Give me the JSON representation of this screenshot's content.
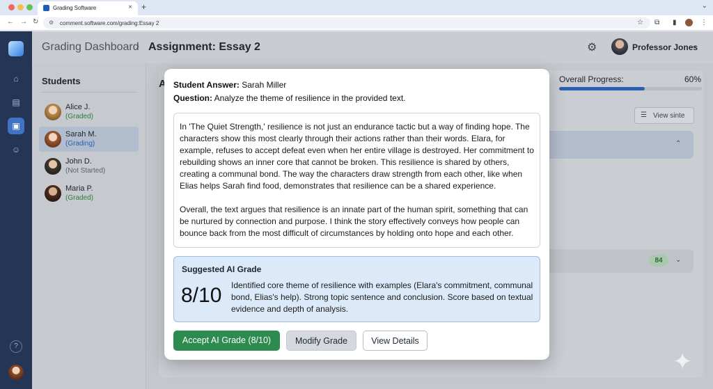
{
  "browser": {
    "tab_title": "Grading Software",
    "tab_close": "×",
    "new_tab": "+",
    "url": "comment.software.com/grading:Essay 2",
    "traffic_colors": [
      "#ed6a5e",
      "#f4bf4f",
      "#61c554"
    ]
  },
  "icons": {
    "back": "←",
    "forward": "→",
    "reload": "↻",
    "site": "⚙",
    "star": "☆",
    "extensions": "⧉",
    "sidebar": "▮",
    "menu": "⋮",
    "dropdown": "⌄",
    "home": "⌂",
    "docs": "▤",
    "grading": "▣",
    "users": "☺",
    "help": "?",
    "gear": "⚙",
    "chevron": "⌄",
    "chevron_up": "⌃",
    "list": "☰",
    "sparkle": "✦"
  },
  "header": {
    "breadcrumb_root": "Grading Dashboard",
    "breadcrumb_sep": "›",
    "page_title": "Assignment: Essay 2",
    "user_name": "Professor Jones"
  },
  "students": {
    "title": "Students",
    "items": [
      {
        "name": "Alice J.",
        "status": "(Graded)",
        "status_color": "#2f7d3c"
      },
      {
        "name": "Sarah M.",
        "status": "(Grading)",
        "status_color": "#2a5fb0"
      },
      {
        "name": "John D.",
        "status": "(Not Started)",
        "status_color": "#5b636e"
      },
      {
        "name": "Maria P.",
        "status": "(Graded)",
        "status_color": "#2f7d3c"
      }
    ]
  },
  "main": {
    "title_initial": "A",
    "progress_label": "Overall Progress:",
    "progress_pct": "60%",
    "progress_value": 0.6,
    "view_button": "View sinte",
    "badge_score": "84"
  },
  "modal": {
    "answer_label": "Student Answer:",
    "student_name": "Sarah Miller",
    "question_label": "Question:",
    "question_text": "Analyze the theme of resilience in the provided text.",
    "answer_p1": "In 'The Quiet Strength,' resilience is not just an endurance tactic but a way of finding hope. The characters show this most clearly through their actions rather than their words. Elara, for example, refuses to accept defeat even when her entire village is destroyed. Her commitment to rebuilding shows an inner core that cannot be broken. This resilience is shared by others, creating a communal bond. The way the characters draw strength from each other, like when Elias helps Sarah find food, demonstrates that resilience can be a shared experience.",
    "answer_p2": "Overall, the text argues that resilience is an innate part of the human spirit, something that can be nurtured by connection and purpose. I think the story effectively conveys how people can bounce back from the most difficult of circumstances by holding onto hope and each other.",
    "ai_title": "Suggested AI Grade",
    "ai_score": "8/10",
    "ai_description": "Identified core theme of resilience with examples (Elara's commitment, communal bond, Elias's help). Strong topic sentence and conclusion. Score based on textual evidence and depth of analysis.",
    "accept_button": "Accept AI Grade (8/10)",
    "modify_button": "Modify Grade",
    "view_details_button": "View Details",
    "accent_green": "#2e8b4f"
  }
}
